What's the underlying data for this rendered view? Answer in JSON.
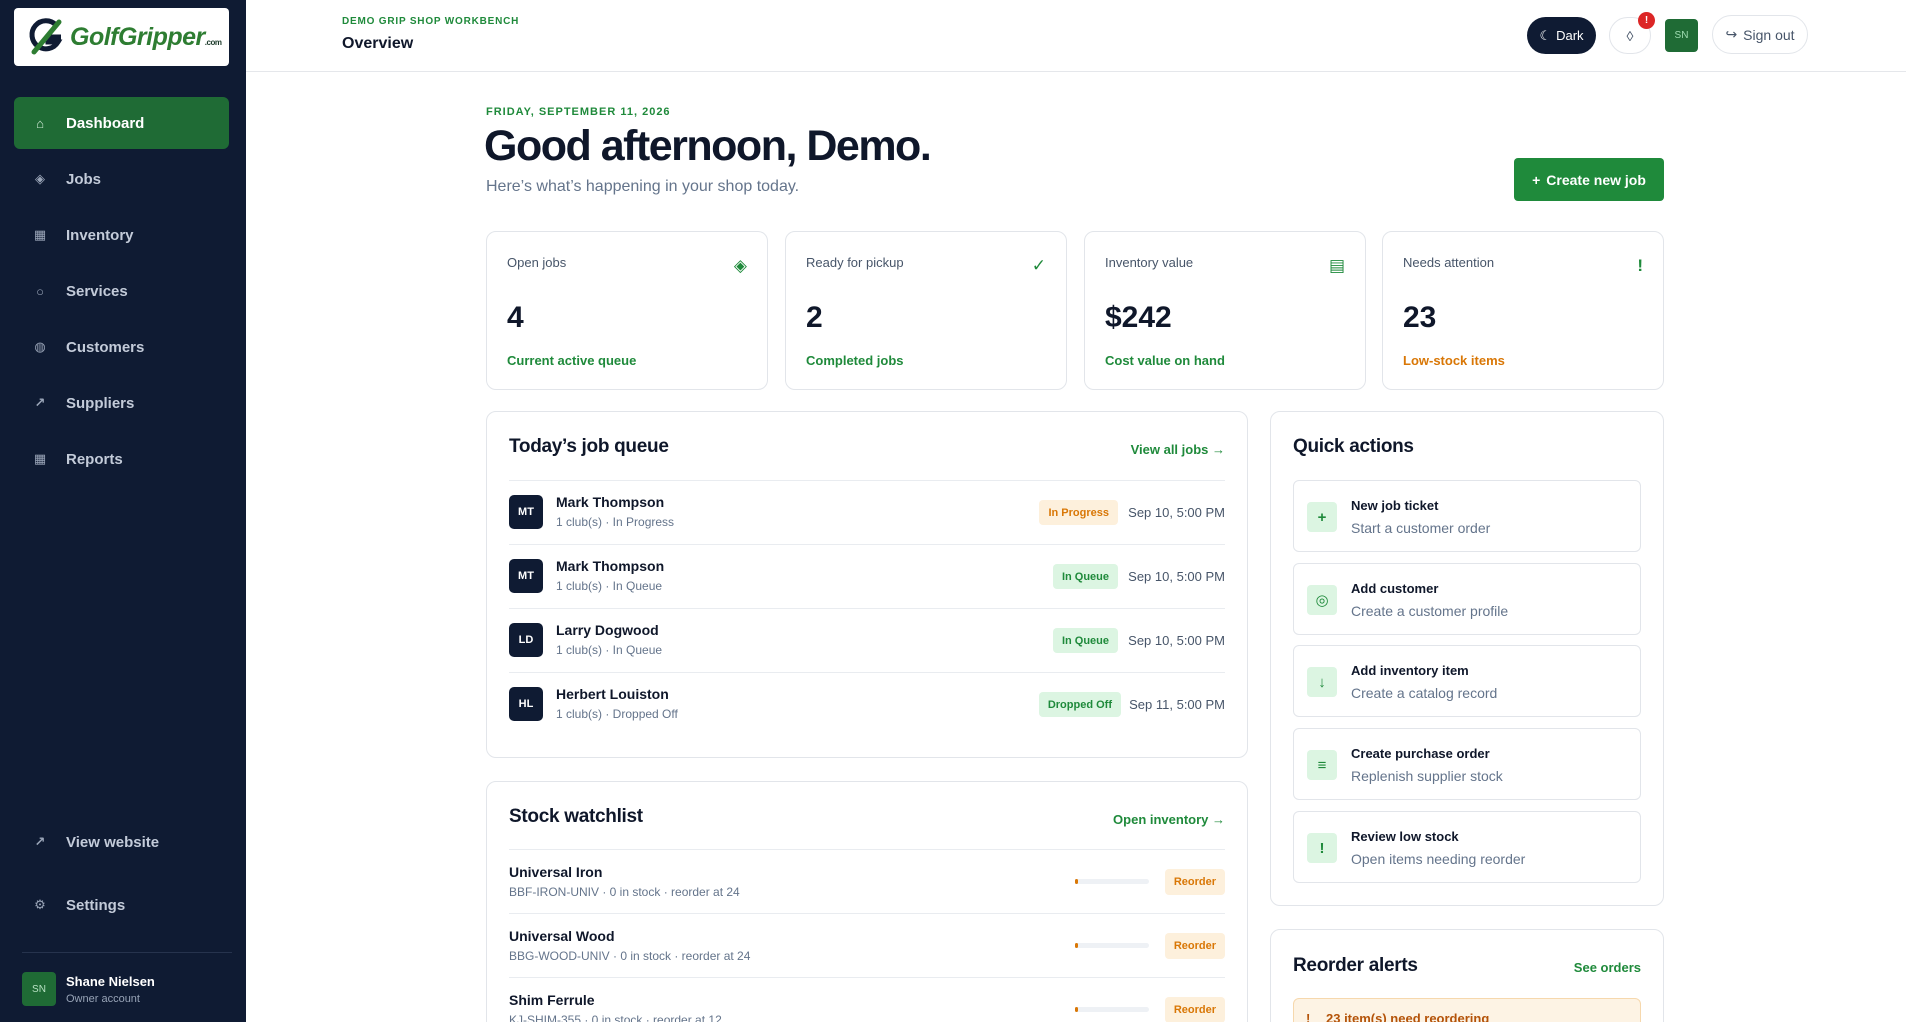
{
  "brand": {
    "name": "GolfGripper",
    "suffix": ".com"
  },
  "sidebar": {
    "items": [
      {
        "label": "Dashboard",
        "icon": "home-icon",
        "glyph": "⌂"
      },
      {
        "label": "Jobs",
        "icon": "diamond-icon",
        "glyph": "◈"
      },
      {
        "label": "Inventory",
        "icon": "grid-icon",
        "glyph": "▦"
      },
      {
        "label": "Services",
        "icon": "circle-icon",
        "glyph": "○"
      },
      {
        "label": "Customers",
        "icon": "customer-icon",
        "glyph": "◍"
      },
      {
        "label": "Suppliers",
        "icon": "arrow-icon",
        "glyph": "↗"
      },
      {
        "label": "Reports",
        "icon": "table-icon",
        "glyph": "▦"
      }
    ],
    "bottom": [
      {
        "label": "View website",
        "icon": "external-link-icon",
        "glyph": "↗"
      },
      {
        "label": "Settings",
        "icon": "gear-icon",
        "glyph": "⚙"
      }
    ],
    "user": {
      "initials": "SN",
      "name": "Shane Nielsen",
      "role": "Owner account"
    }
  },
  "topbar": {
    "crumb": "DEMO GRIP SHOP WORKBENCH",
    "title": "Overview",
    "theme_label": "Dark",
    "theme_glyph": "☾",
    "bell_glyph": "◊",
    "bell_badge": "!",
    "avatar_initials": "SN",
    "signout_label": "Sign out",
    "signout_glyph": "↪"
  },
  "header": {
    "date": "FRIDAY, SEPTEMBER 11, 2026",
    "greeting": "Good afternoon, Demo.",
    "subtitle": "Here’s what’s happening in your shop today.",
    "create_label": "Create new job",
    "create_glyph": "+"
  },
  "stats": [
    {
      "label": "Open jobs",
      "value": "4",
      "foot": "Current active queue",
      "icon": "diamond-icon",
      "glyph": "◈"
    },
    {
      "label": "Ready for pickup",
      "value": "2",
      "foot": "Completed jobs",
      "icon": "check-icon",
      "glyph": "✓"
    },
    {
      "label": "Inventory value",
      "value": "$242",
      "foot": "Cost value on hand",
      "icon": "ledger-icon",
      "glyph": "▤"
    },
    {
      "label": "Needs attention",
      "value": "23",
      "foot": "Low-stock items",
      "icon": "alert-icon",
      "glyph": "!"
    }
  ],
  "job_queue": {
    "title": "Today’s job queue",
    "link": "View all jobs →",
    "rows": [
      {
        "initials": "MT",
        "name": "Mark Thompson",
        "meta": "1 club(s) · In Progress",
        "status": "In Progress",
        "tone": "amber",
        "date": "Sep 10, 5:00 PM"
      },
      {
        "initials": "MT",
        "name": "Mark Thompson",
        "meta": "1 club(s) · In Queue",
        "status": "In Queue",
        "tone": "green",
        "date": "Sep 10, 5:00 PM"
      },
      {
        "initials": "LD",
        "name": "Larry Dogwood",
        "meta": "1 club(s) · In Queue",
        "status": "In Queue",
        "tone": "green",
        "date": "Sep 10, 5:00 PM"
      },
      {
        "initials": "HL",
        "name": "Herbert Louiston",
        "meta": "1 club(s) · Dropped Off",
        "status": "Dropped Off",
        "tone": "green",
        "date": "Sep 11, 5:00 PM"
      }
    ]
  },
  "stock_watchlist": {
    "title": "Stock watchlist",
    "link": "Open inventory →",
    "rows": [
      {
        "name": "Universal Iron",
        "meta": "BBF-IRON-UNIV · 0 in stock · reorder at 24",
        "badge": "Reorder",
        "level": 0.0
      },
      {
        "name": "Universal Wood",
        "meta": "BBG-WOOD-UNIV · 0 in stock · reorder at 24",
        "badge": "Reorder",
        "level": 0.0
      },
      {
        "name": "Shim Ferrule",
        "meta": "KJ-SHIM-355 · 0 in stock · reorder at 12",
        "badge": "Reorder",
        "level": 0.0
      }
    ]
  },
  "quick_actions": {
    "title": "Quick actions",
    "items": [
      {
        "title": "New job ticket",
        "sub": "Start a customer order",
        "icon": "plus-icon",
        "glyph": "+"
      },
      {
        "title": "Add customer",
        "sub": "Create a customer profile",
        "icon": "target-icon",
        "glyph": "◎"
      },
      {
        "title": "Add inventory item",
        "sub": "Create a catalog record",
        "icon": "download-icon",
        "glyph": "↓"
      },
      {
        "title": "Create purchase order",
        "sub": "Replenish supplier stock",
        "icon": "list-icon",
        "glyph": "≡"
      },
      {
        "title": "Review low stock",
        "sub": "Open items needing reorder",
        "icon": "alert-icon",
        "glyph": "!"
      }
    ]
  },
  "reorder_alerts": {
    "title": "Reorder alerts",
    "link": "See orders",
    "alert": "23 item(s) need reordering",
    "alert_glyph": "!"
  },
  "colors": {
    "sidebar": "#0f1b33",
    "accent": "#1f8a3b",
    "warning": "#d97706"
  }
}
